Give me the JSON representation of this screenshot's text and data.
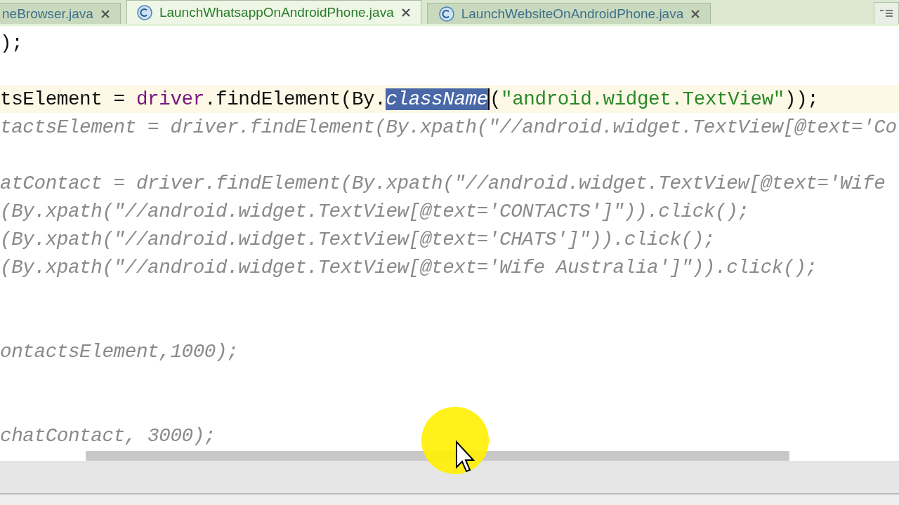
{
  "tabs": [
    {
      "label": "neBrowser.java",
      "selected": false,
      "icon": false
    },
    {
      "label": "LaunchWhatsappOnAndroidPhone.java",
      "selected": true,
      "icon": true
    },
    {
      "label": "LaunchWebsiteOnAndroidPhone.java",
      "selected": false,
      "icon": true
    }
  ],
  "lines": [
    {
      "kind": "code",
      "current": false,
      "segments": [
        {
          "text": ");",
          "kind": "plain"
        }
      ]
    },
    {
      "kind": "blank"
    },
    {
      "kind": "code",
      "current": true,
      "segments": [
        {
          "text": "tsElement = ",
          "kind": "plain"
        },
        {
          "text": "driver",
          "kind": "field"
        },
        {
          "text": ".findElement(By.",
          "kind": "plain"
        },
        {
          "text": "className",
          "kind": "selected"
        },
        {
          "text": "(",
          "kind": "plain"
        },
        {
          "text": "\"android.widget.TextView\"",
          "kind": "string"
        },
        {
          "text": "));",
          "kind": "plain"
        }
      ]
    },
    {
      "kind": "code",
      "current": false,
      "segments": [
        {
          "text": "tactsElement = driver.findElement(By.xpath(\"//android.widget.TextView[@text='Co",
          "kind": "muted"
        }
      ]
    },
    {
      "kind": "blank"
    },
    {
      "kind": "code",
      "current": false,
      "segments": [
        {
          "text": "atContact = driver.findElement(By.xpath(\"//android.widget.TextView[@text='Wife",
          "kind": "muted"
        }
      ]
    },
    {
      "kind": "code",
      "current": false,
      "segments": [
        {
          "text": "(By.xpath(\"//android.widget.TextView[@text='CONTACTS']\")).click();",
          "kind": "muted"
        }
      ]
    },
    {
      "kind": "code",
      "current": false,
      "segments": [
        {
          "text": "(By.xpath(\"//android.widget.TextView[@text='CHATS']\")).click();",
          "kind": "muted"
        }
      ]
    },
    {
      "kind": "code",
      "current": false,
      "segments": [
        {
          "text": "(By.xpath(\"//android.widget.TextView[@text='Wife Australia']\")).click();",
          "kind": "muted"
        }
      ]
    },
    {
      "kind": "blank"
    },
    {
      "kind": "blank"
    },
    {
      "kind": "code",
      "current": false,
      "segments": [
        {
          "text": "ontactsElement,1000);",
          "kind": "muted"
        }
      ]
    },
    {
      "kind": "blank"
    },
    {
      "kind": "blank"
    },
    {
      "kind": "code",
      "current": false,
      "segments": [
        {
          "text": "chatContact, 3000);",
          "kind": "muted"
        }
      ]
    }
  ]
}
